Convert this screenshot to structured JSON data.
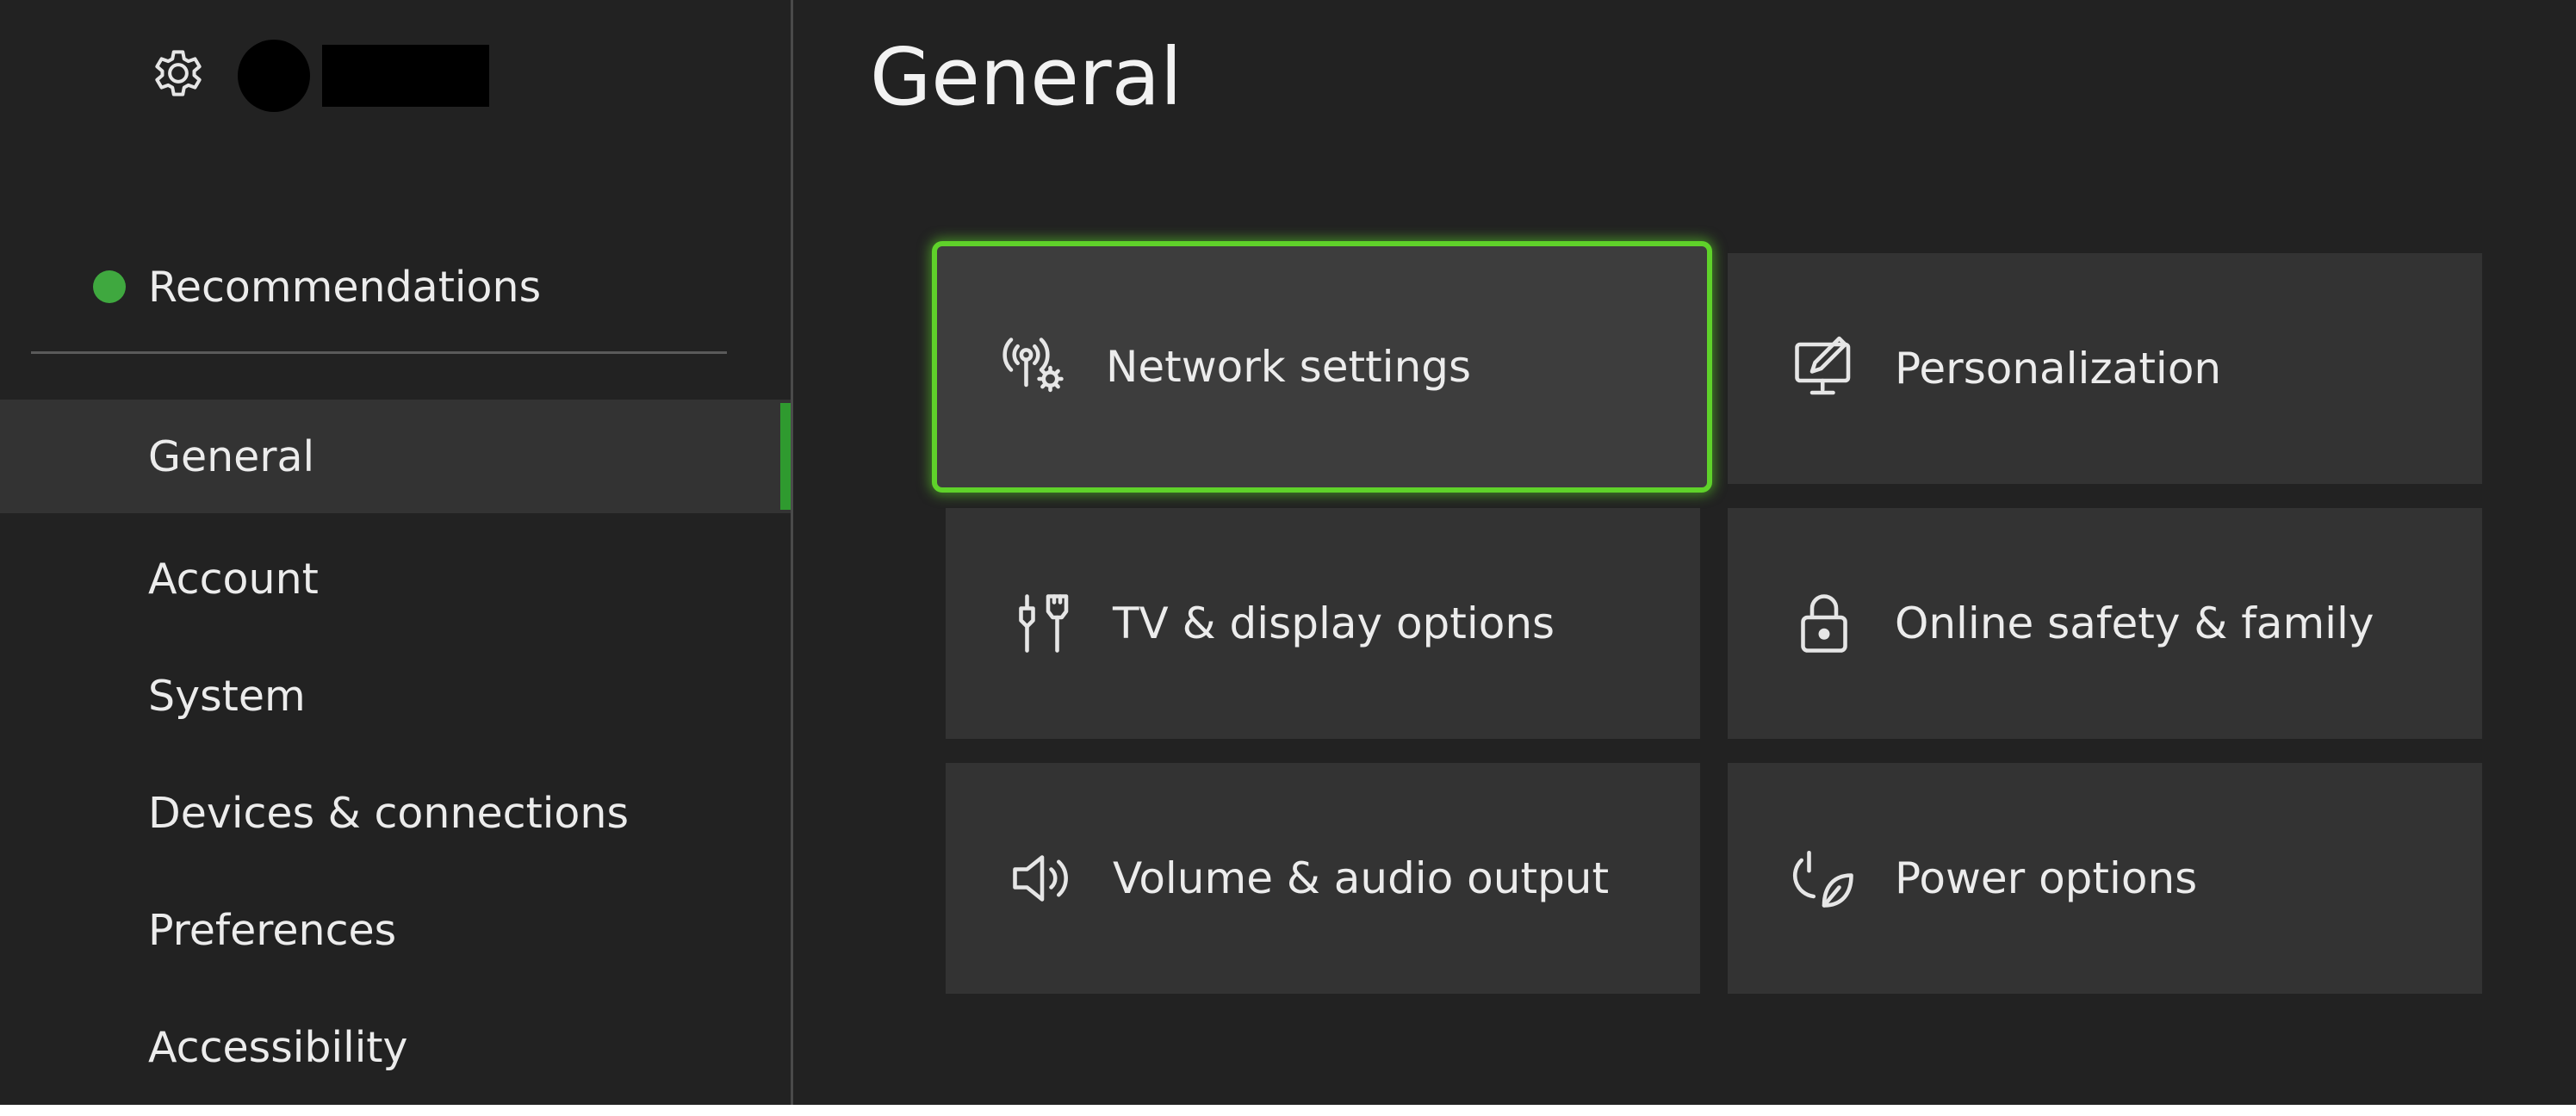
{
  "header": {
    "title": "General"
  },
  "sidebar": {
    "recommendations_label": "Recommendations",
    "items": [
      {
        "label": "General",
        "active": true
      },
      {
        "label": "Account"
      },
      {
        "label": "System"
      },
      {
        "label": "Devices & connections"
      },
      {
        "label": "Preferences"
      },
      {
        "label": "Accessibility"
      }
    ]
  },
  "tiles": [
    {
      "label": "Network settings",
      "icon": "network-settings-icon",
      "focused": true
    },
    {
      "label": "Personalization",
      "icon": "personalization-icon"
    },
    {
      "label": "TV & display options",
      "icon": "tv-display-icon"
    },
    {
      "label": "Online safety & family",
      "icon": "lock-icon"
    },
    {
      "label": "Volume & audio output",
      "icon": "speaker-icon"
    },
    {
      "label": "Power options",
      "icon": "power-leaf-icon"
    }
  ],
  "colors": {
    "background": "#222222",
    "tile": "#333333",
    "focus": "#5fd22a",
    "accent": "#2f9a2f",
    "recommendation_dot": "#3fa83f"
  }
}
